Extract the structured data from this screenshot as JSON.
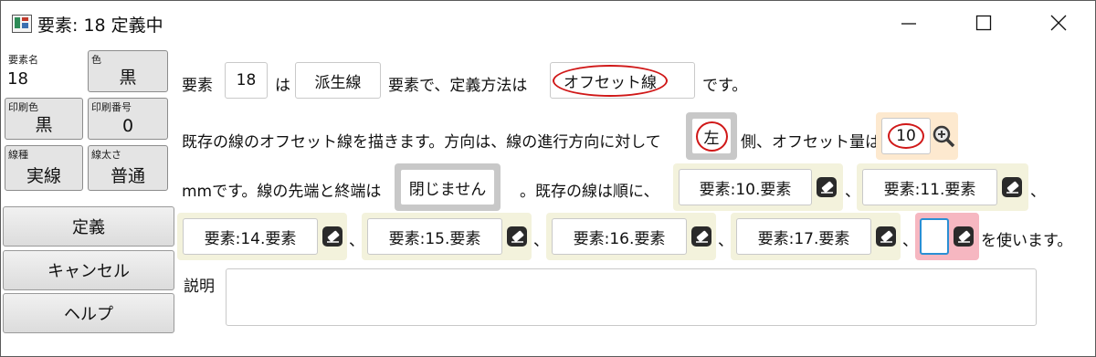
{
  "window": {
    "title": "要素: 18 定義中",
    "controls": [
      "minimize-icon",
      "maximize-icon",
      "close-icon"
    ]
  },
  "props": {
    "name": {
      "caption": "要素名",
      "value": "18"
    },
    "color": {
      "caption": "色",
      "value": "黒"
    },
    "print_color": {
      "caption": "印刷色",
      "value": "黒"
    },
    "print_number": {
      "caption": "印刷番号",
      "value": "0"
    },
    "line_type": {
      "caption": "線種",
      "value": "実線"
    },
    "line_width": {
      "caption": "線太さ",
      "value": "普通"
    }
  },
  "commands": {
    "define": "定義",
    "cancel": "キャンセル",
    "help": "ヘルプ"
  },
  "sentence": {
    "s1": "要素",
    "element_id": "18",
    "s2": "は",
    "kind": "派生線",
    "s3": "要素で、定義方法は",
    "method": "オフセット線",
    "s4": "です。",
    "s5": "既存の線のオフセット線を描きます。方向は、線の進行方向に対して",
    "direction": "左",
    "s6": "側、オフセット量は",
    "offset": "10",
    "s7": "mmです。線の先端と終端は",
    "closure": "閉じません",
    "s8": "。既存の線は順に、",
    "sep": "、",
    "lines": [
      "要素:10.要素",
      "要素:11.要素",
      "要素:14.要素",
      "要素:15.要素",
      "要素:16.要素",
      "要素:17.要素"
    ],
    "new_line_value": "",
    "s9": "を使います。"
  },
  "description": {
    "label": "説明",
    "value": ""
  },
  "icons": {
    "zoom": "zoom-in-icon",
    "picker": "eraser-icon"
  }
}
